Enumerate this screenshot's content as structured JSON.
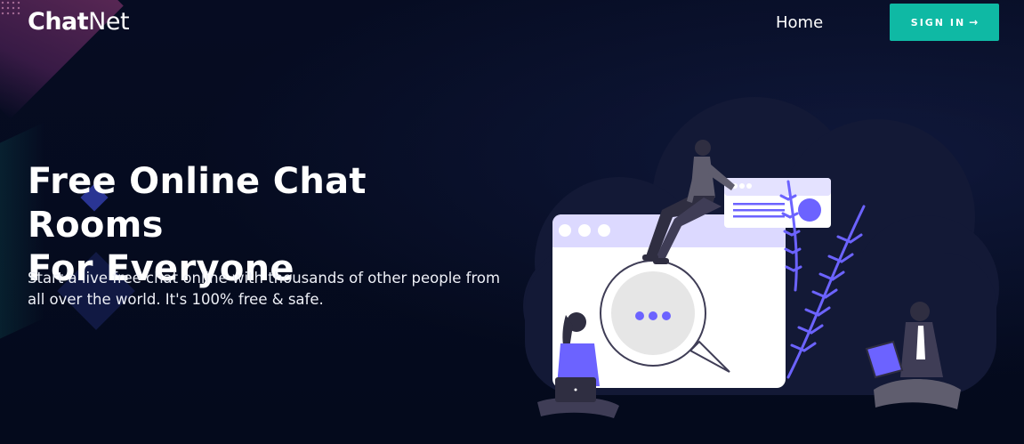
{
  "header": {
    "logo_bold": "Chat",
    "logo_light": "Net",
    "nav_home": "Home",
    "sign_in_label": "SIGN IN",
    "sign_in_icon": "arrow-right-icon"
  },
  "hero": {
    "title_line1": "Free Online Chat Rooms",
    "title_line2": "For Everyone",
    "subtitle": "Start a live free chat online with thousands of other people from all over the world. It's 100% free & safe."
  },
  "colors": {
    "background": "#050b1f",
    "accent": "#0fb9a4",
    "illustration_purple": "#6c63ff",
    "cloud": "#141a3a"
  }
}
